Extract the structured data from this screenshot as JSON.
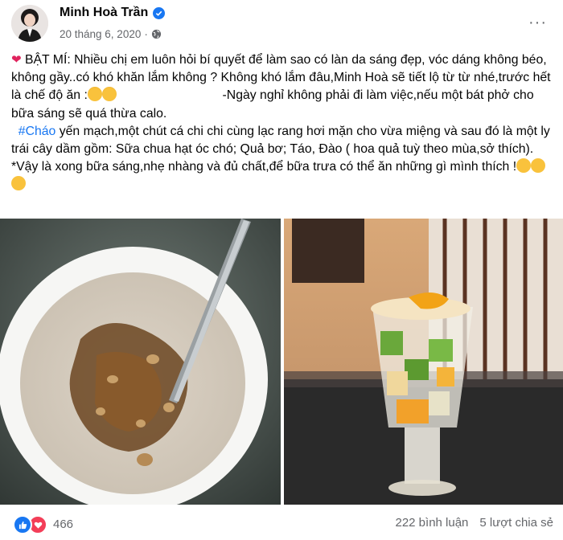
{
  "post": {
    "author": "Minh Hoà Trần",
    "date": "20 tháng 6, 2020",
    "more_label": "···",
    "paragraph1_a": "BẬT MÍ: Nhiều chị em luôn hỏi bí quyết để làm sao có làn da sáng đẹp, vóc dáng không béo, không gầy..có khó khăn lắm không ? Không khó lắm đâu,Minh Hoà sẽ tiết lộ từ từ nhé,trước hết là chế độ ăn :",
    "paragraph1_b": "                              -Ngày nghỉ không phải đi làm việc,nếu một bát phở cho bữa sáng sẽ quá thừa calo.",
    "hashtag": "#Cháo",
    "paragraph2": " yến mạch,một chút cá chi chi cùng lạc rang hơi mặn cho vừa miệng và sau đó là một ly trái cây dầm gồm: Sữa chua hạt óc chó; Quả bơ; Táo, Đào ( hoa quả tuỳ theo mùa,sở thích).  *Vậy là xong bữa sáng,nhẹ nhàng và đủ chất,để bữa trưa có thể ăn những gì mình thích !"
  },
  "footer": {
    "reaction_count": "466",
    "comments": "222 bình luận",
    "shares": "5 lượt chia sẻ"
  }
}
